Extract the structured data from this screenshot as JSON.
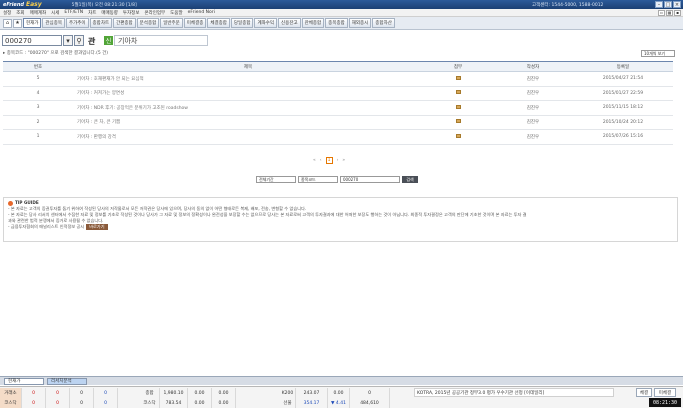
{
  "titlebar": {
    "logo": "eFriend",
    "logo2": "Easy",
    "title": "5월1일(목) 오전 08:21:30 [1/8]",
    "center": "고객센터: 1544-5000, 1588-0012"
  },
  "menu": [
    "설정",
    "조회",
    "매매계좌",
    "시세",
    "ETF/ETN",
    "차트",
    "매매동향",
    "투자정보",
    "온라인업무",
    "도움말",
    "eFriend Nori"
  ],
  "toolbar": {
    "tabs": [
      "현재가",
      "관심종목",
      "주가추이",
      "종합차트",
      "간편종합",
      "분석종합",
      "일반주문",
      "미체결종",
      "체결종합",
      "당일종합",
      "계좌수익",
      "신용잔고",
      "잔체종합",
      "종목종합",
      "해외종시",
      "종합자산"
    ]
  },
  "search": {
    "code": "000270",
    "kwan": "관",
    "badge": "신",
    "name": "기아차"
  },
  "list": {
    "info": "▸ 종목코드 : \"000270\" 으로 검색한 결과입니다.(5 건)",
    "view_select": "10개씩 보기",
    "headers": {
      "num": "번호",
      "title": "제목",
      "attach": "첨부",
      "author": "작성자",
      "date": "등록일"
    },
    "rows": [
      {
        "num": "5",
        "title": "기아차 : 호재편재가 안 되는 요심적",
        "author": "김진우",
        "date": "2015/04/27 21:54"
      },
      {
        "num": "4",
        "title": "기아차 : 커져가는 양면성",
        "author": "김진우",
        "date": "2015/01/27 22:59"
      },
      {
        "num": "3",
        "title": "기아차 : NDR 후기: 공장먹은 분위기가 고조된 roadshow",
        "author": "김진우",
        "date": "2015/11/15 18:12"
      },
      {
        "num": "2",
        "title": "기아차 : 큰 차, 큰 기쁨",
        "author": "김진우",
        "date": "2015/10/24 20:12"
      },
      {
        "num": "1",
        "title": "기아차 : 판행의 강격",
        "author": "김진우",
        "date": "2015/07/26 15:16"
      }
    ]
  },
  "pager": {
    "first": "«",
    "prev": "‹",
    "current": "1",
    "next": "›",
    "last": "»"
  },
  "searchform": {
    "period": "전체기간",
    "field": "종목코드",
    "value": "000270",
    "button": "검색"
  },
  "tip": {
    "title": "TIP GUIDE",
    "line1": "- 본 자료는 고객의 증권투자를 돕기 위하여 작성된 당사의 저작물로서 모든 저작권은 당사에 있으며, 당사의 동의 없이 어떤 형태로든 복제, 배포, 전송, 변형할 수 없습니다.",
    "line2": "- 본 자료는 당사 리서치 센터에서 수집한 자료 및 정보를 기초로 작성된 것이나 당사가 그 자료 및 정보의 정확성이나 완전성을 보장할 수는 없으므로 당사는 본 자료로써 고객의 투자결과에 대한 어떠한 보장도 행하는 것이 아닙니다. 최종적 투자결정은 고객의 판단에 기초한 것이며 본 자료는 투자 결",
    "line3": "과와 관련한 법적 분쟁에서 증거로 사용될 수 없습니다.",
    "line4": "- 금융투자협회의 애널리스트 인적정보 공시",
    "link": "바로가기"
  },
  "tasks": [
    "현재가",
    "리서치분석"
  ],
  "status": {
    "r1_label": "거래소",
    "r2_label": "코스닥",
    "r1_vals": [
      "0",
      "0",
      "0",
      "0"
    ],
    "r2_vals": [
      "0",
      "0",
      "0",
      "0"
    ],
    "kospi_label": "종합",
    "kospi_val": "1,980.10",
    "kospi_chg": "0.00",
    "kospi_pct": "0.00",
    "kosdaq_label": "코스닥",
    "kosdaq_val": "783.54",
    "kosdaq_chg": "0.00",
    "kosdaq_pct": "0.00",
    "k200_label": "K200",
    "k200_val": "243.07",
    "k200_chg": "0.00",
    "k200_vol": "0",
    "fut_label": "선물",
    "fut_val": "354.17",
    "fut_chg": "▼ 4.41",
    "fut_vol": "484,610",
    "ticker": "KOTRA, 2015년 공공기관 정부3.0 평가 우수기관 선정 [이데일리]",
    "btn1": "체결",
    "btn2": "미체결",
    "clock": "08:21:30"
  }
}
